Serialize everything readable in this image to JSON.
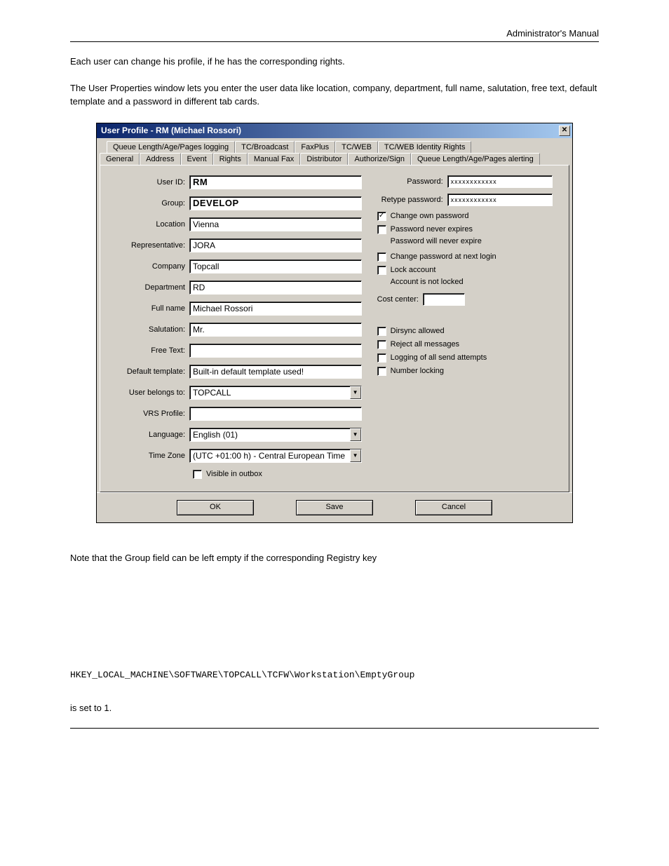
{
  "header": {
    "doc_title": "Administrator's Manual"
  },
  "intro": {
    "p1": "Each user can change his profile, if he has the corresponding rights.",
    "p2": "The User Properties window lets you enter the user data like location, company, department, full name, salutation, free text, default template and a password in different tab cards."
  },
  "dialog": {
    "title": "User Profile - RM (Michael Rossori)",
    "tabs_row1": [
      "Queue Length/Age/Pages logging",
      "TC/Broadcast",
      "FaxPlus",
      "TC/WEB",
      "TC/WEB Identity Rights"
    ],
    "tabs_row2": [
      "General",
      "Address",
      "Event",
      "Rights",
      "Manual Fax",
      "Distributor",
      "Authorize/Sign",
      "Queue Length/Age/Pages alerting"
    ],
    "active_tab": "General",
    "fields": {
      "user_id": {
        "label": "User ID:",
        "value": "RM"
      },
      "group": {
        "label": "Group:",
        "value": "DEVELOP"
      },
      "location": {
        "label": "Location",
        "value": "Vienna"
      },
      "representative": {
        "label": "Representative:",
        "value": "JORA"
      },
      "company": {
        "label": "Company",
        "value": "Topcall"
      },
      "department": {
        "label": "Department",
        "value": "RD"
      },
      "full_name": {
        "label": "Full name",
        "value": "Michael Rossori"
      },
      "salutation": {
        "label": "Salutation:",
        "value": "Mr."
      },
      "free_text": {
        "label": "Free Text:",
        "value": ""
      },
      "default_template": {
        "label": "Default template:",
        "value": "Built-in default template used!"
      },
      "user_belongs_to": {
        "label": "User belongs to:",
        "value": "TOPCALL"
      },
      "vrs_profile": {
        "label": "VRS Profile:",
        "value": ""
      },
      "language": {
        "label": "Language:",
        "value": "English (01)"
      },
      "time_zone": {
        "label": "Time Zone",
        "value": "(UTC +01:00 h) - Central European Time"
      }
    },
    "visible_outbox": {
      "label": "Visible in outbox",
      "checked": false
    },
    "right": {
      "password": {
        "label": "Password:",
        "value": "xxxxxxxxxxxx"
      },
      "retype_password": {
        "label": "Retype password:",
        "value": "xxxxxxxxxxxx"
      },
      "change_own": {
        "label": "Change own password",
        "checked": true
      },
      "never_expires": {
        "label": "Password never expires",
        "checked": false,
        "sub": "Password will never expire"
      },
      "change_next": {
        "label": "Change password at next login",
        "checked": false
      },
      "lock_account": {
        "label": "Lock account",
        "checked": false,
        "sub": "Account is not locked"
      },
      "cost_center": {
        "label": "Cost center:",
        "value": ""
      },
      "dirsync": {
        "label": "Dirsync allowed",
        "checked": false
      },
      "reject_all": {
        "label": "Reject all messages",
        "checked": false
      },
      "logging_all": {
        "label": "Logging of all send attempts",
        "checked": false
      },
      "number_locking": {
        "label": "Number locking",
        "checked": false
      }
    },
    "buttons": {
      "ok": "OK",
      "save": "Save",
      "cancel": "Cancel"
    }
  },
  "note": {
    "p1": "Note that the Group field can be left empty if the corresponding Registry key",
    "code": "HKEY_LOCAL_MACHINE\\SOFTWARE\\TOPCALL\\TCFW\\Workstation\\EmptyGroup",
    "p2": "is set to 1."
  }
}
